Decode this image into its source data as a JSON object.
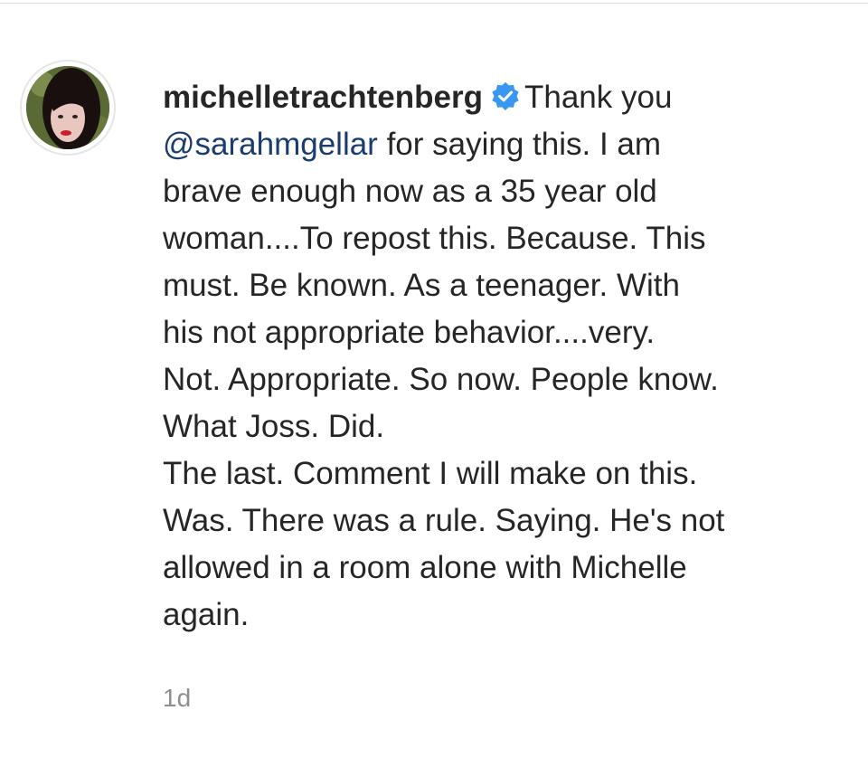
{
  "comment": {
    "username": "michelletrachtenberg",
    "verified": true,
    "verified_icon": "verified-badge-icon",
    "avatar_icon": "avatar",
    "text_before_mention": "Thank you ",
    "mention": "@sarahmgellar",
    "text_lines": [
      " for saying this. I am",
      "brave enough now as a 35 year old",
      "woman....To repost this. Because. This",
      "must. Be known. As a teenager. With",
      "his not appropriate behavior....very.",
      "Not. Appropriate. So now. People know.",
      "What Joss. Did.",
      "The last. Comment I will make on this.",
      "Was. There was a rule. Saying. He's not",
      "allowed in a room alone with Michelle",
      "again."
    ],
    "timestamp": "1d"
  },
  "colors": {
    "text": "#262626",
    "mention": "#1b3c70",
    "verified_badge": "#3897f0",
    "timestamp": "#8e8e8e",
    "divider": "#dbdbdb"
  }
}
